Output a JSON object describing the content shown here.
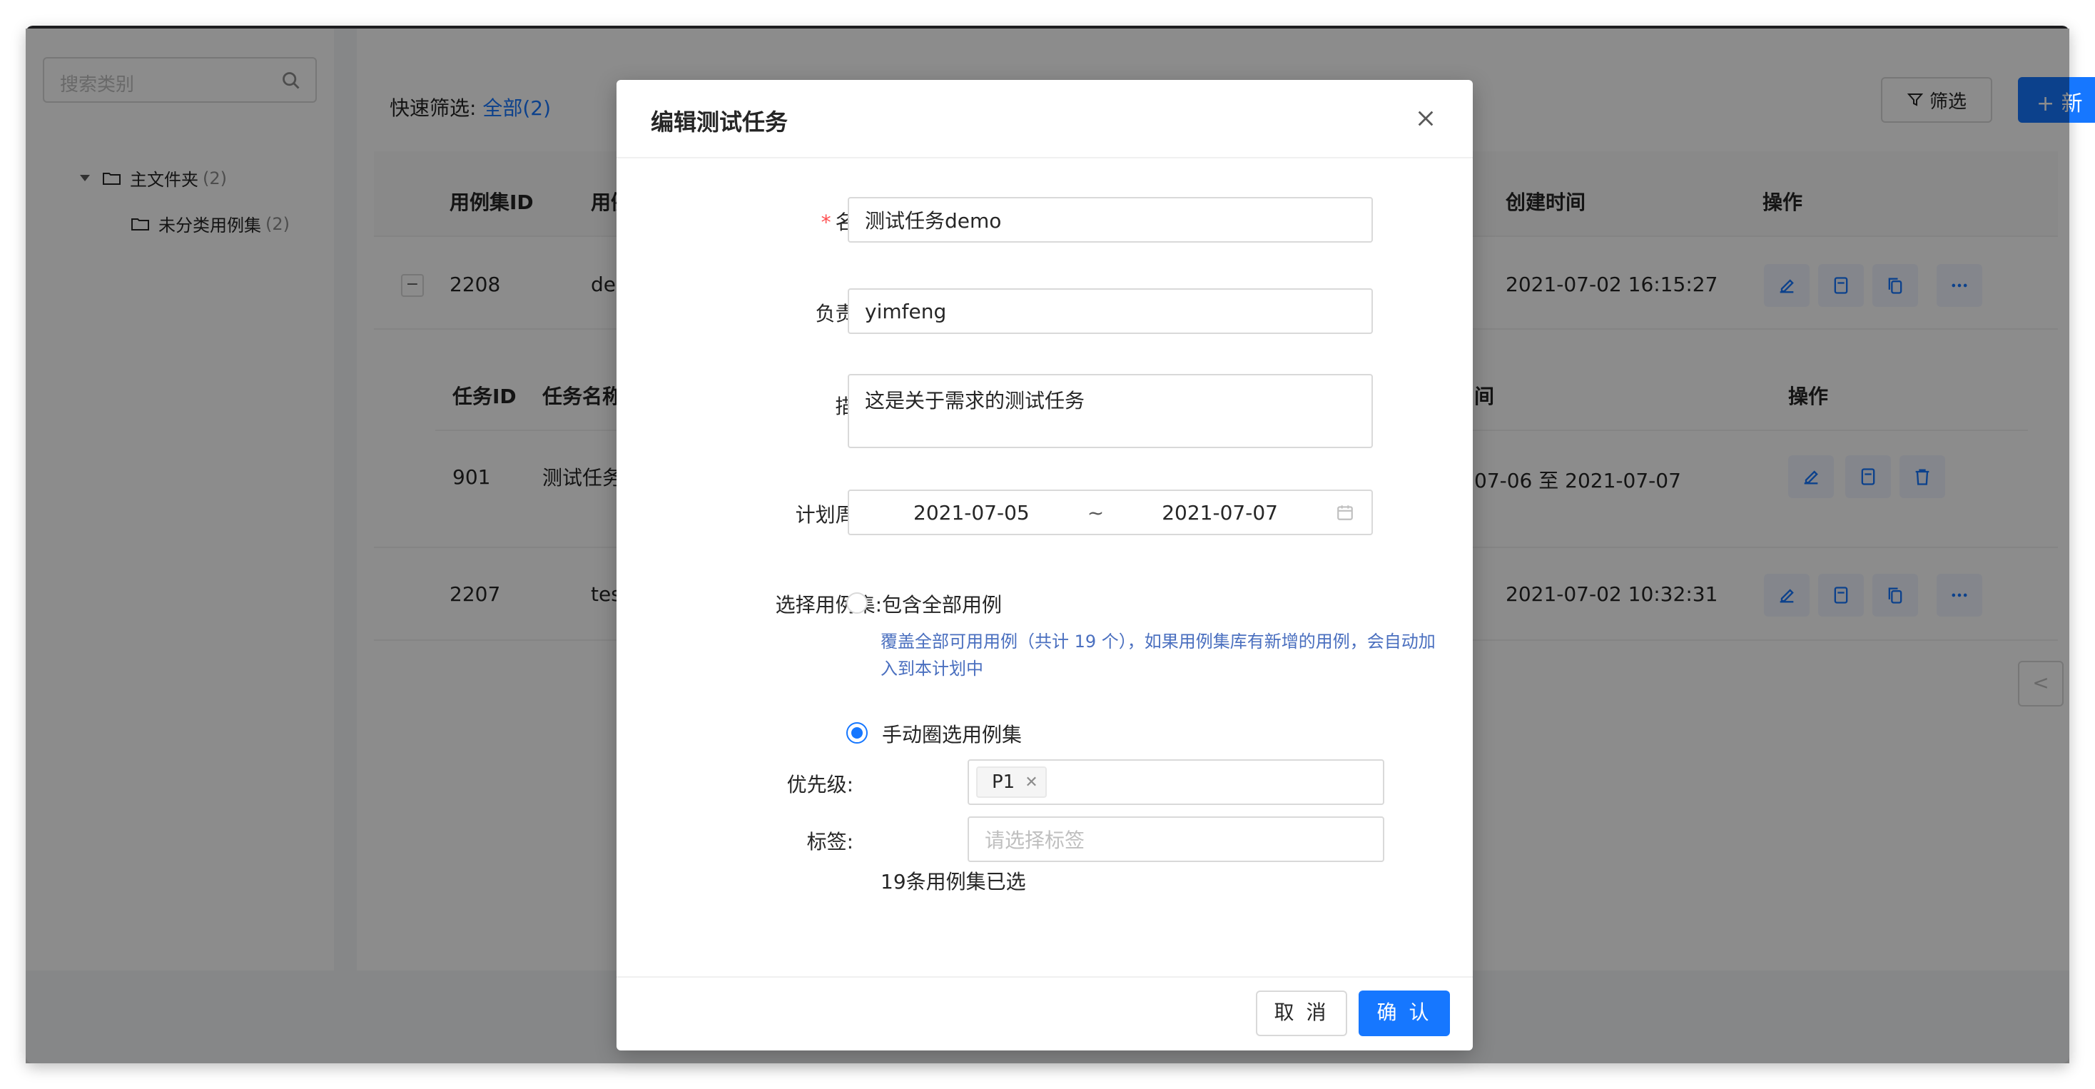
{
  "sidebar": {
    "search_placeholder": "搜索类别",
    "tree": [
      {
        "label": "主文件夹",
        "count": "(2)"
      },
      {
        "label": "未分类用例集",
        "count": "(2)"
      }
    ]
  },
  "toolbar": {
    "quick_filter_label": "快速筛选:",
    "quick_filter_value": "全部(2)",
    "filter_button": "筛选",
    "new_button": "+ 新"
  },
  "table": {
    "headers": {
      "id": "用例集ID",
      "name": "用例",
      "created": "创建时间",
      "actions": "操作"
    },
    "rows": [
      {
        "expand": "−",
        "id": "2208",
        "name": "de",
        "created": "2021-07-02 16:15:27"
      },
      {
        "id": "2207",
        "name": "tes",
        "created": "2021-07-02 10:32:31"
      }
    ],
    "subtable": {
      "headers": {
        "id": "任务ID",
        "name": "任务名称",
        "period": "间",
        "actions": "操作"
      },
      "rows": [
        {
          "id": "901",
          "name": "测试任务",
          "period": "07-06 至 2021-07-07"
        }
      ]
    },
    "pager_prev": "<",
    "collapse_handle": "⇆"
  },
  "modal": {
    "title": "编辑测试任务",
    "fields": {
      "name_label": "名称:",
      "name_value": "测试任务demo",
      "owner_label": "负责人:",
      "owner_value": "yimfeng",
      "desc_label": "描述:",
      "desc_value": "这是关于需求的测试任务",
      "period_label": "计划周期:",
      "period_start": "2021-07-05",
      "period_sep": "~",
      "period_end": "2021-07-07",
      "caseset_label": "选择用例集:",
      "option_all": "包含全部用例",
      "option_all_hint": "覆盖全部可用用例（共计 19 个），如果用例集库有新增的用例，会自动加入到本计划中",
      "option_manual": "手动圈选用例集",
      "priority_label": "优先级:",
      "priority_tag": "P1",
      "tag_label": "标签:",
      "tag_placeholder": "请选择标签",
      "selected_count": "19条用例集已选"
    },
    "cancel": "取 消",
    "ok": "确 认"
  },
  "colors": {
    "primary": "#1677ff",
    "required": "#ff4d4f",
    "mask": "rgba(0,0,0,0.45)"
  }
}
